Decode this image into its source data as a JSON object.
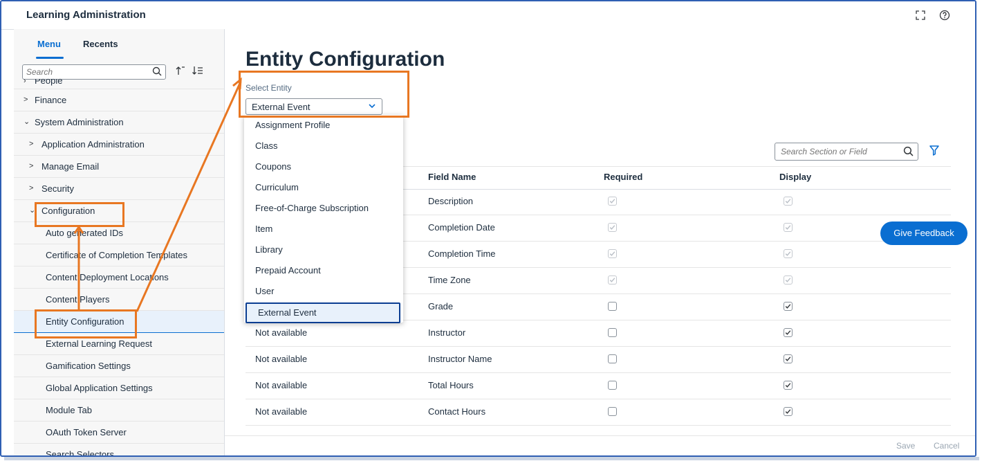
{
  "app": {
    "title": "Learning Administration"
  },
  "topbar": {
    "fullscreen_icon": "fullscreen-icon",
    "help_icon": "help-icon"
  },
  "sidebar": {
    "tabs": [
      {
        "label": "Menu",
        "active": true
      },
      {
        "label": "Recents",
        "active": false
      }
    ],
    "search_placeholder": "Search",
    "items": [
      {
        "label": "People",
        "level": 0,
        "expanded": false
      },
      {
        "label": "Finance",
        "level": 0,
        "expanded": false
      },
      {
        "label": "System Administration",
        "level": 0,
        "expanded": true
      },
      {
        "label": "Application Administration",
        "level": 1,
        "expanded": false
      },
      {
        "label": "Manage Email",
        "level": 1,
        "expanded": false
      },
      {
        "label": "Security",
        "level": 1,
        "expanded": false
      },
      {
        "label": "Configuration",
        "level": 1,
        "expanded": true
      },
      {
        "label": "Auto generated IDs",
        "level": 2
      },
      {
        "label": "Certificate of Completion Templates",
        "level": 2
      },
      {
        "label": "Content Deployment Locations",
        "level": 2
      },
      {
        "label": "Content Players",
        "level": 2
      },
      {
        "label": "Entity Configuration",
        "level": 2,
        "selected": true
      },
      {
        "label": "External Learning Request",
        "level": 2
      },
      {
        "label": "Gamification Settings",
        "level": 2
      },
      {
        "label": "Global Application Settings",
        "level": 2
      },
      {
        "label": "Module Tab",
        "level": 2
      },
      {
        "label": "OAuth Token Server",
        "level": 2
      },
      {
        "label": "Search Selectors",
        "level": 2
      }
    ]
  },
  "main": {
    "title": "Entity Configuration",
    "select_label": "Select Entity",
    "selected_entity": "External Event",
    "dropdown_options": [
      "Assignment Profile",
      "Class",
      "Coupons",
      "Curriculum",
      "Free-of-Charge Subscription",
      "Item",
      "Library",
      "Prepaid Account",
      "User",
      "External Event"
    ],
    "table_search_placeholder": "Search Section or Field",
    "columns": {
      "field_name": "Field Name",
      "required": "Required",
      "display": "Display"
    },
    "rows": [
      {
        "section": "",
        "field": "Description",
        "required": true,
        "required_disabled": true,
        "display": true,
        "display_disabled": true
      },
      {
        "section": "",
        "field": "Completion Date",
        "required": true,
        "required_disabled": true,
        "display": true,
        "display_disabled": true
      },
      {
        "section": "",
        "field": "Completion Time",
        "required": true,
        "required_disabled": true,
        "display": true,
        "display_disabled": true
      },
      {
        "section": "",
        "field": "Time Zone",
        "required": true,
        "required_disabled": true,
        "display": true,
        "display_disabled": true
      },
      {
        "section": "",
        "field": "Grade",
        "required": false,
        "required_disabled": false,
        "display": true,
        "display_disabled": false
      },
      {
        "section": "Not available",
        "field": "Instructor",
        "required": false,
        "required_disabled": false,
        "display": true,
        "display_disabled": false
      },
      {
        "section": "Not available",
        "field": "Instructor Name",
        "required": false,
        "required_disabled": false,
        "display": true,
        "display_disabled": false
      },
      {
        "section": "Not available",
        "field": "Total Hours",
        "required": false,
        "required_disabled": false,
        "display": true,
        "display_disabled": false
      },
      {
        "section": "Not available",
        "field": "Contact Hours",
        "required": false,
        "required_disabled": false,
        "display": true,
        "display_disabled": false
      }
    ],
    "feedback_label": "Give Feedback",
    "footer": {
      "save": "Save",
      "cancel": "Cancel"
    }
  },
  "colors": {
    "accent": "#0a6ed1",
    "annotation": "#e87722",
    "frame": "#2f5fb3"
  }
}
